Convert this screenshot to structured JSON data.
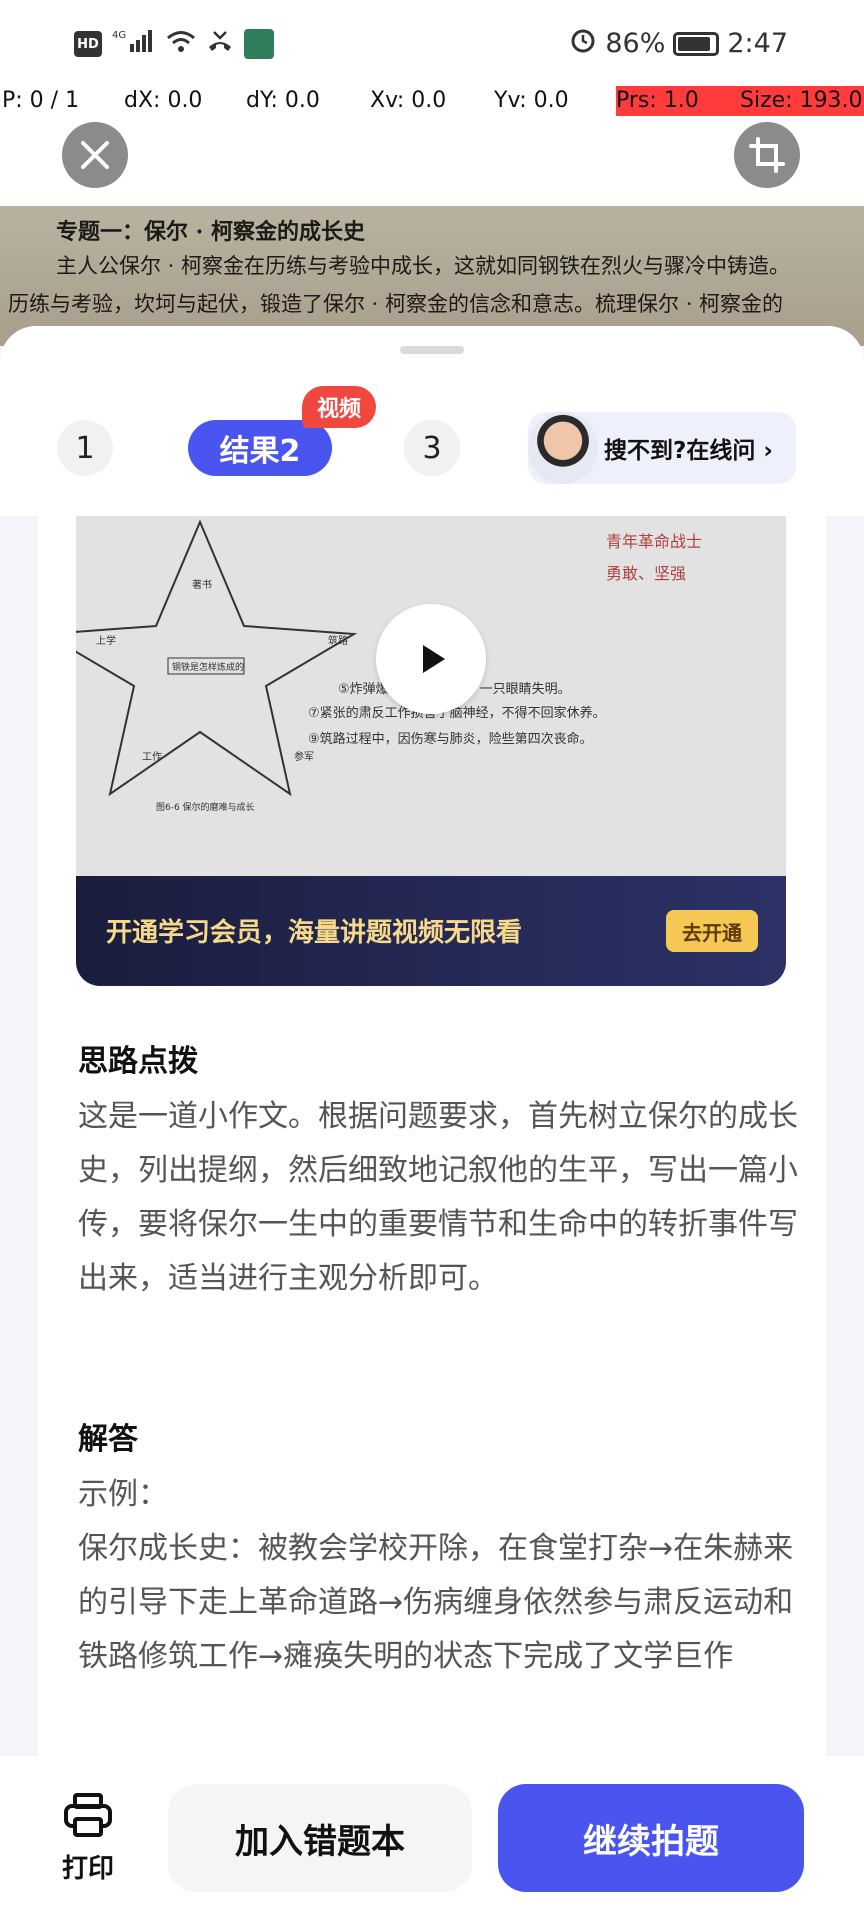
{
  "status_bar": {
    "network_badge": "HD",
    "signal": "4G",
    "battery": "86%",
    "time": "2:47"
  },
  "debug": {
    "pointer": "P: 0 / 1",
    "dx": "dX: 0.0",
    "dy": "dY: 0.0",
    "xv": "Xv: 0.0",
    "yv": "Yv: 0.0",
    "prs": "Prs: 1.0",
    "size": "Size: 193.0"
  },
  "photo": {
    "line1": "专题一：保尔 · 柯察金的成长史",
    "line2": "主人公保尔 · 柯察金在历练与考验中成长，这就如同钢铁在烈火与骤冷中铸造。",
    "line3": "历练与考验，坎坷与起伏，锻造了保尔 · 柯察金的信念和意志。梳理保尔 · 柯察金的"
  },
  "tabs": {
    "tab1": "1",
    "tab2": "结果2",
    "tab2_badge": "视频",
    "tab3": "3",
    "ask_label": "搜不到?在线问 ›"
  },
  "video": {
    "notes": [
      "⑤炸弹爆炸，头部受伤，一只眼睛失明。",
      "⑦紧张的肃反工作损害了脑神经，不得不回家休养。",
      "⑨筑路过程中，因伤寒与肺炎，险些第四次丧命。"
    ],
    "hand_notes": [
      "青年革命战士",
      "勇敢、坚强"
    ],
    "promo_text": "开通学习会员，海量讲题视频无限看",
    "promo_button": "去开通"
  },
  "analysis": {
    "title": "思路点拨",
    "body": "这是一道小作文。根据问题要求，首先树立保尔的成长史，列出提纲，然后细致地记叙他的生平，写出一篇小传，要将保尔一生中的重要情节和生命中的转折事件写出来，适当进行主观分析即可。"
  },
  "answer": {
    "title": "解答",
    "example_label": "示例：",
    "body": "保尔成长史：被教会学校开除，在食堂打杂→在朱赫来的引导下走上革命道路→伤病缠身依然参与肃反运动和铁路修筑工作→瘫痪失明的状态下完成了文学巨作"
  },
  "bottom": {
    "print_label": "打印",
    "add_wrong": "加入错题本",
    "continue": "继续拍题"
  },
  "colors": {
    "accent": "#4a55f0",
    "badge": "#f0473f",
    "promo_bg": "#1a1d3d",
    "promo_text": "#f7d98a"
  }
}
